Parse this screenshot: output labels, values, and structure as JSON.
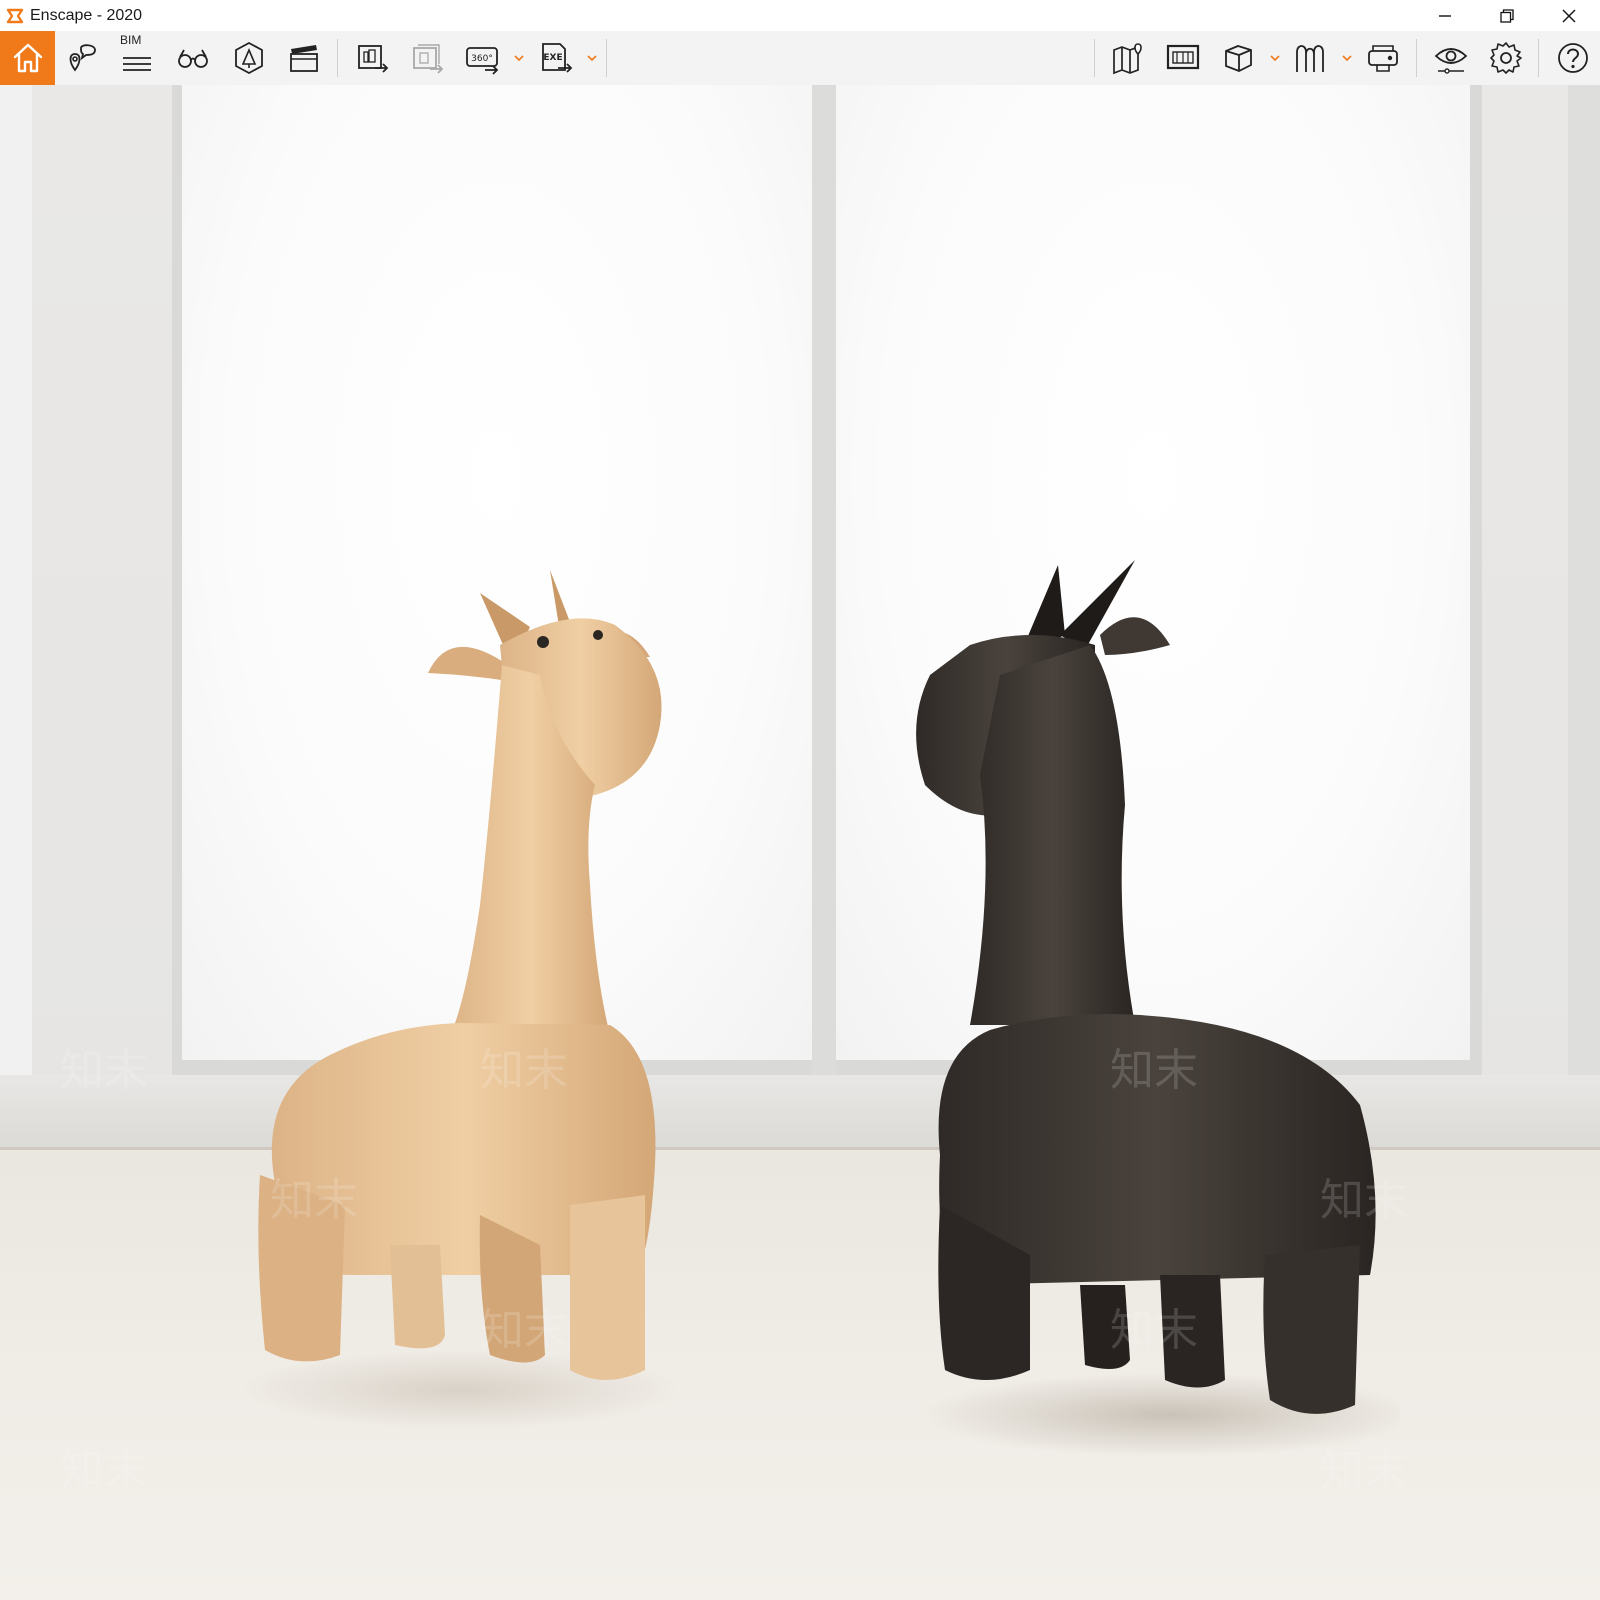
{
  "window": {
    "title": "Enscape - 2020",
    "controls": [
      "minimize-icon",
      "restore-icon",
      "close-icon"
    ]
  },
  "toolbar": {
    "accent_color": "#f07a1a",
    "bim_label": "BIM",
    "panorama_label": "360°",
    "exe_label": "EXE",
    "left_group": [
      "home-icon",
      "views-icon",
      "bim-info-icon",
      "walk-mode-icon",
      "asset-library-icon",
      "video-editor-icon"
    ],
    "export_group": [
      "screenshot-export-icon",
      "batch-render-icon",
      "panorama-export-icon",
      "exe-export-icon"
    ],
    "right_group": [
      "map-icon",
      "collaborative-annotation-icon",
      "capture-cube-icon",
      "material-editor-icon",
      "vr-headset-icon",
      "visual-settings-icon",
      "general-settings-icon",
      "help-icon"
    ]
  },
  "viewport": {
    "scene": "render-preview",
    "watermark_text": "知末"
  }
}
